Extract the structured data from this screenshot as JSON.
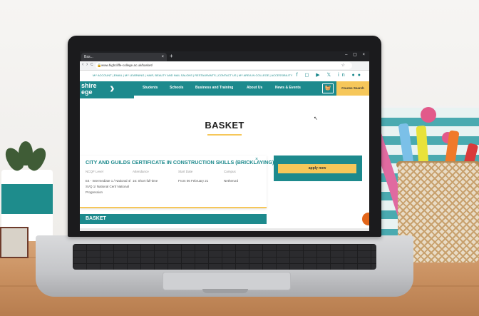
{
  "browser": {
    "tab_label": "Bas...",
    "tab_close": "×",
    "new_tab": "+",
    "window_controls": "– ▢ ×",
    "url": "www.highcliffe-college.ac.uk/basket/",
    "nav_back": "‹",
    "nav_forward": "›",
    "nav_reload": "C"
  },
  "site": {
    "top_links": "MY ACCOUNT | EMAIL | MY LEARNING | HAIR, BEAUTY AND NAIL SALONS | RESTAURANTS | CONTACT US | MY AREA IN COLLEGE | ACCESSIBILITY",
    "socials": "f ◻ ▶ 𝕏 in ●●",
    "logo_line1": "shire",
    "logo_line2": "ege",
    "nav": [
      "Students",
      "Schools",
      "Business and Training",
      "About Us",
      "News & Events"
    ],
    "course_search": "Course Search",
    "page_title": "BASKET",
    "course": {
      "title": "CITY AND GUILDS CERTIFICATE IN CONSTRUCTION SKILLS (BRICKLAYING)",
      "close": "×",
      "headers": [
        "NCQF Level",
        "Attendance",
        "Start Date",
        "Campus"
      ],
      "values": [
        "E4 - Intermediate 1 / National 4/ SVQ 1/ National Cert/ National Progression",
        "16: Short full-time",
        "From 06 February 21",
        "Netherurd"
      ]
    },
    "apply_label": "apply now",
    "basket_bar": "BASKET"
  },
  "colors": {
    "brand_teal": "#1d8a8d",
    "accent_yellow": "#f6c75a"
  }
}
